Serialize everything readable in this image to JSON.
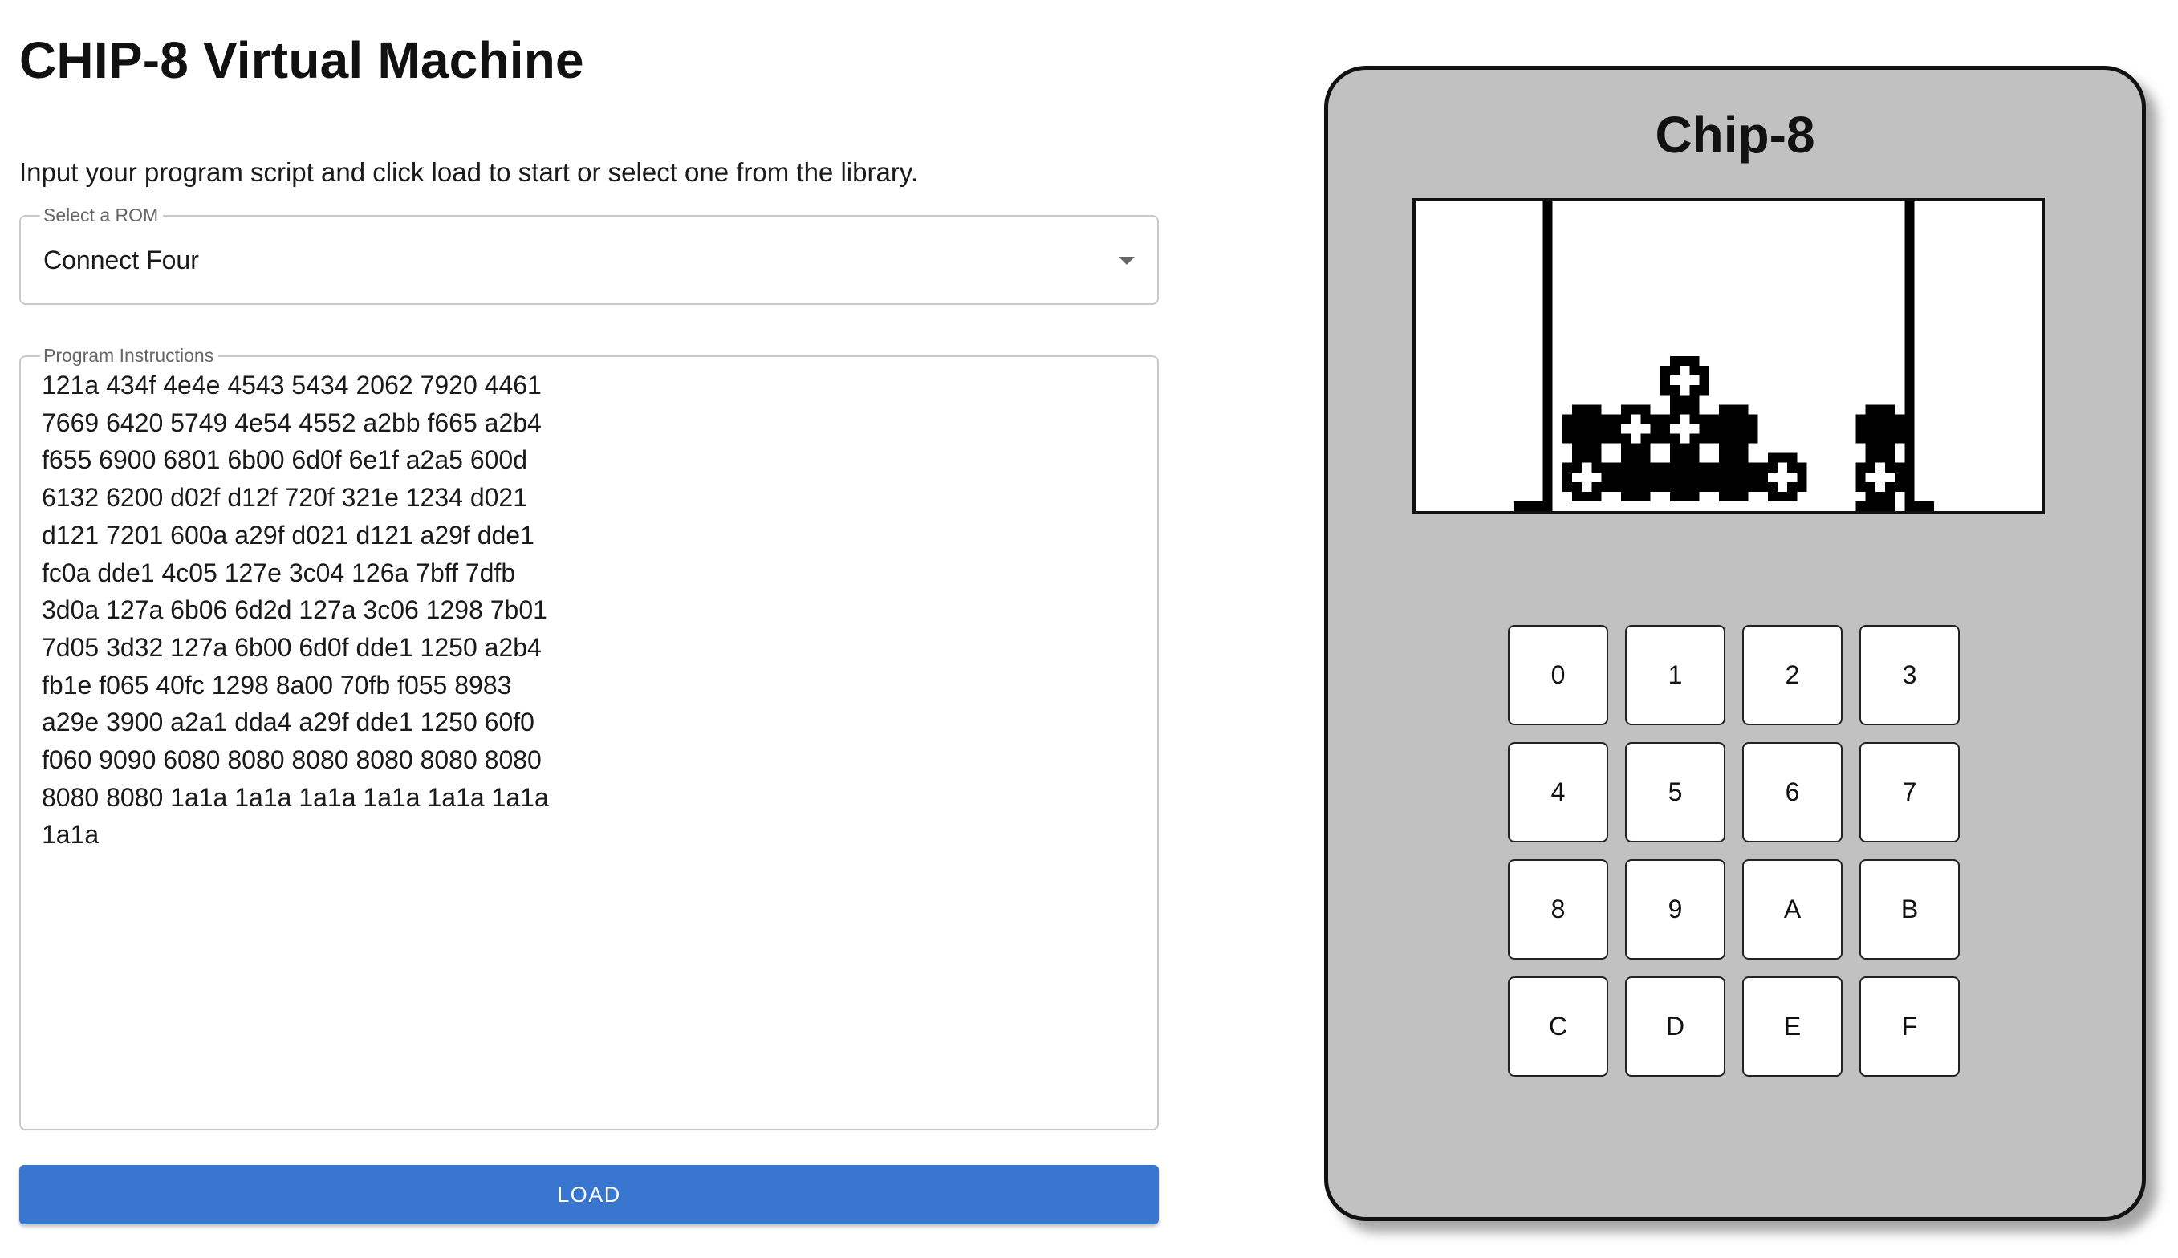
{
  "page": {
    "title": "CHIP-8 Virtual Machine",
    "intro": "Input your program script and click load to start or select one from the library."
  },
  "rom_select": {
    "label": "Select a ROM",
    "value": "Connect Four",
    "icon": "chevron-down-icon"
  },
  "program": {
    "label": "Program Instructions",
    "lines": [
      "121a 434f 4e4e 4543 5434 2062 7920 4461",
      "7669 6420 5749 4e54 4552 a2bb f665 a2b4",
      "f655 6900 6801 6b00 6d0f 6e1f a2a5 600d",
      "6132 6200 d02f d12f 720f 321e 1234 d021",
      "d121 7201 600a a29f d021 d121 a29f dde1",
      "fc0a dde1 4c05 127e 3c04 126a 7bff 7dfb",
      "3d0a 127a 6b06 6d2d 127a 3c06 1298 7b01",
      "7d05 3d32 127a 6b00 6d0f dde1 1250 a2b4",
      "fb1e f065 40fc 1298 8a00 70fb f055 8983",
      "a29e 3900 a2a1 dda4 a29f dde1 1250 60f0",
      "f060 9090 6080 8080 8080 8080 8080 8080",
      "8080 8080 1a1a 1a1a 1a1a 1a1a 1a1a 1a1a",
      "1a1a"
    ]
  },
  "actions": {
    "load_label": "LOAD",
    "load_color": "#3876d0"
  },
  "device": {
    "title": "Chip-8",
    "body_color": "#c1c1c1",
    "keys": [
      "0",
      "1",
      "2",
      "3",
      "4",
      "5",
      "6",
      "7",
      "8",
      "9",
      "A",
      "B",
      "C",
      "D",
      "E",
      "F"
    ]
  }
}
